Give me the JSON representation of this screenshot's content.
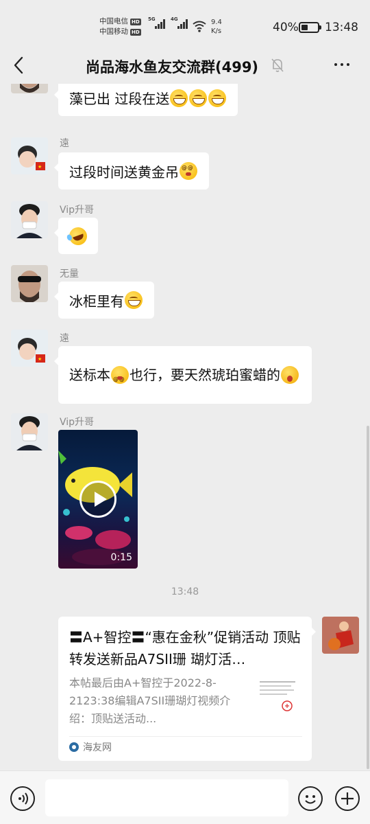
{
  "status_bar": {
    "carrier1": "中国电信",
    "carrier2": "中国移动",
    "hd_badge": "HD",
    "sig1_gen": "5G",
    "sig2_gen": "4G",
    "net_speed_value": "9.4",
    "net_speed_unit": "K/s",
    "battery_percent": "40%",
    "battery_level": 0.4,
    "time": "13:48"
  },
  "header": {
    "title": "尚品海水鱼友交流群(499)",
    "back_icon": "chevron-left-icon",
    "mute_icon": "bell-off-icon",
    "more_icon": "ellipsis-icon"
  },
  "messages": [
    {
      "sender": "",
      "text": "藻已出 过段在送",
      "emojis": [
        "grin",
        "grin",
        "grin"
      ]
    },
    {
      "sender": "遠",
      "text": "过段时间送黄金吊",
      "emojis": [
        "dizzy"
      ]
    },
    {
      "sender": "Vip升哥",
      "text": "",
      "emojis": [
        "laughcry"
      ]
    },
    {
      "sender": "无量",
      "text": "冰柜里有",
      "emojis": [
        "grin"
      ]
    },
    {
      "sender": "遠",
      "text_a": "送标本",
      "text_b": "也行，要天然琥珀蜜蜡的",
      "emojis": [
        "dizzy",
        "wow"
      ]
    },
    {
      "sender": "Vip升哥",
      "video_duration": "0:15"
    }
  ],
  "timestamp": "13:48",
  "link_card": {
    "title": "〓A+智控〓“惠在金秋”促销活动 顶贴转发送新品A7SII珊 瑚灯活…",
    "description": "本帖最后由A+智控于2022-8-2123:38编辑A7SII珊瑚灯视频介绍：顶贴送活动...",
    "source": "海友网"
  },
  "input_bar": {
    "placeholder": "",
    "voice_icon": "voice-icon",
    "emoji_icon": "emoji-icon",
    "plus_icon": "plus-icon"
  },
  "colors": {
    "background": "#ededed",
    "bubble": "#ffffff",
    "text": "#111111",
    "muted": "#888888"
  }
}
